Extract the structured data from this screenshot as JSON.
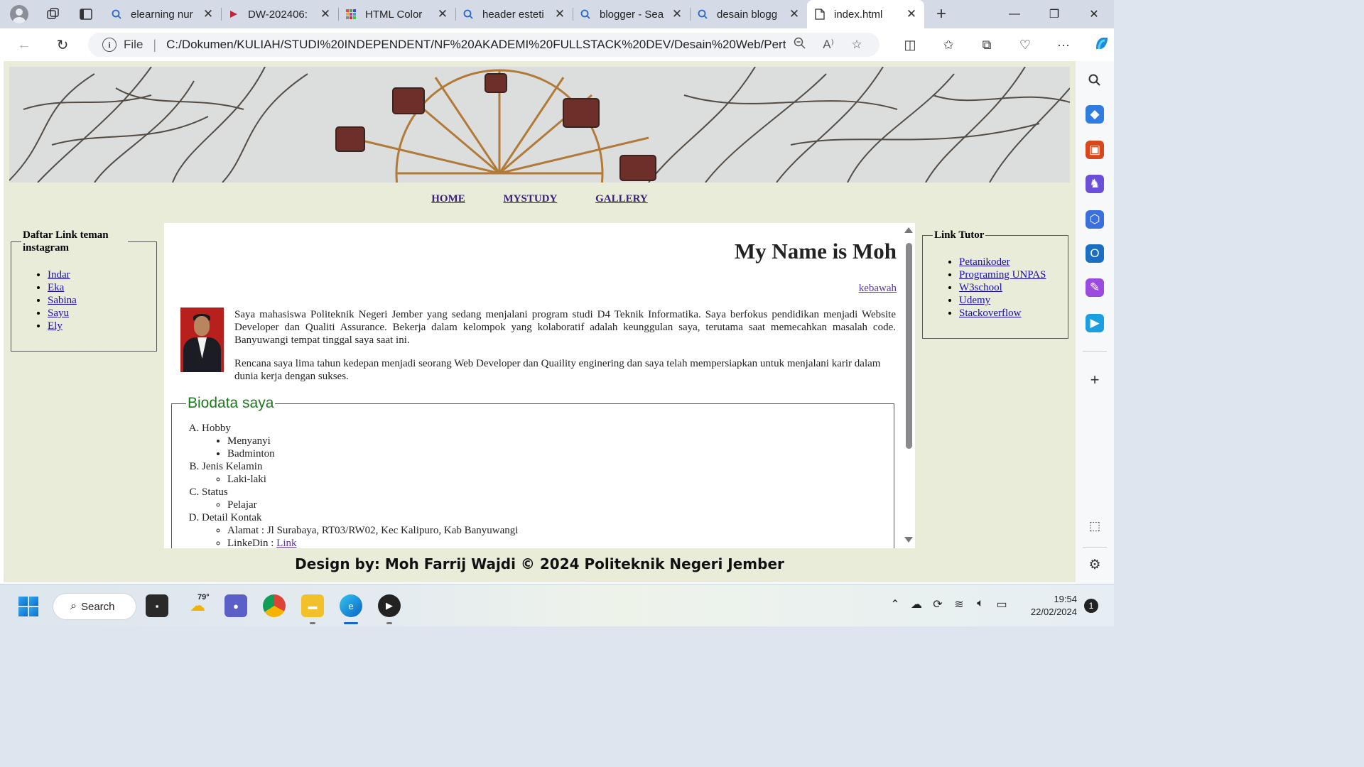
{
  "browser": {
    "tabs": [
      {
        "title": "elearning nur",
        "icon": "search-icon"
      },
      {
        "title": "DW-202406:",
        "icon": "site-icon"
      },
      {
        "title": "HTML Color",
        "icon": "color-grid-icon"
      },
      {
        "title": "header esteti",
        "icon": "search-icon"
      },
      {
        "title": "blogger - Sea",
        "icon": "search-icon"
      },
      {
        "title": "desain blogg",
        "icon": "search-icon"
      },
      {
        "title": "index.html",
        "icon": "file-icon",
        "active": true
      }
    ],
    "address": {
      "scheme": "File",
      "url": "C:/Dokumen/KULIAH/STUDI%20INDEPENDENT/NF%20AKADEMI%20FULLSTACK%20DEV/Desain%20Web/Perte..."
    }
  },
  "page": {
    "nav": [
      "HOME",
      "MYSTUDY",
      "GALLERY"
    ],
    "left_panel": {
      "title": "Daftar Link teman instagram",
      "links": [
        "Indar",
        "Eka",
        "Sabina",
        "Sayu",
        "Ely"
      ]
    },
    "right_panel": {
      "title": "Link Tutor",
      "links": [
        "Petanikoder",
        "Programing UNPAS",
        "W3school",
        "Udemy",
        "Stackoverflow"
      ]
    },
    "main": {
      "heading": "My Name is Moh",
      "jump_link": "kebawah",
      "para1": "Saya mahasiswa Politeknik Negeri Jember yang sedang menjalani program studi D4 Teknik Informatika. Saya berfokus pendidikan menjadi Website Developer dan Qualiti Assurance. Bekerja dalam kelompok yang kolaboratif adalah keunggulan saya, terutama saat memecahkan masalah code. Banyuwangi tempat tinggal saya saat ini.",
      "para2": "Rencana saya lima tahun kedepan menjadi seorang Web Developer dan Quaility enginering dan saya telah mempersiapkan untuk menjalani karir dalam dunia kerja dengan sukses.",
      "bio_title": "Biodata saya",
      "bio": {
        "hobby_label": "Hobby",
        "hobbies": [
          "Menyanyi",
          "Badminton"
        ],
        "gender_label": "Jenis Kelamin",
        "gender": "Laki-laki",
        "status_label": "Status",
        "status": "Pelajar",
        "contact_label": "Detail Kontak",
        "address": "Alamat : Jl Surabaya, RT03/RW02, Kec Kalipuro, Kab Banyuwangi",
        "linkedin_label": "LinkeDin : ",
        "linkedin_link": "Link"
      }
    },
    "footer": "Design by: Moh Farrij Wajdi © 2024 Politeknik Negeri Jember"
  },
  "taskbar": {
    "search": "Search",
    "weather": "79°",
    "time": "19:54",
    "date": "22/02/2024",
    "notifications": "1"
  },
  "colors": {
    "page_bg": "#e9ecd8",
    "bio_title": "#1c7a1c",
    "link": "#1a0dab",
    "visited_link": "#5a3aa0"
  }
}
